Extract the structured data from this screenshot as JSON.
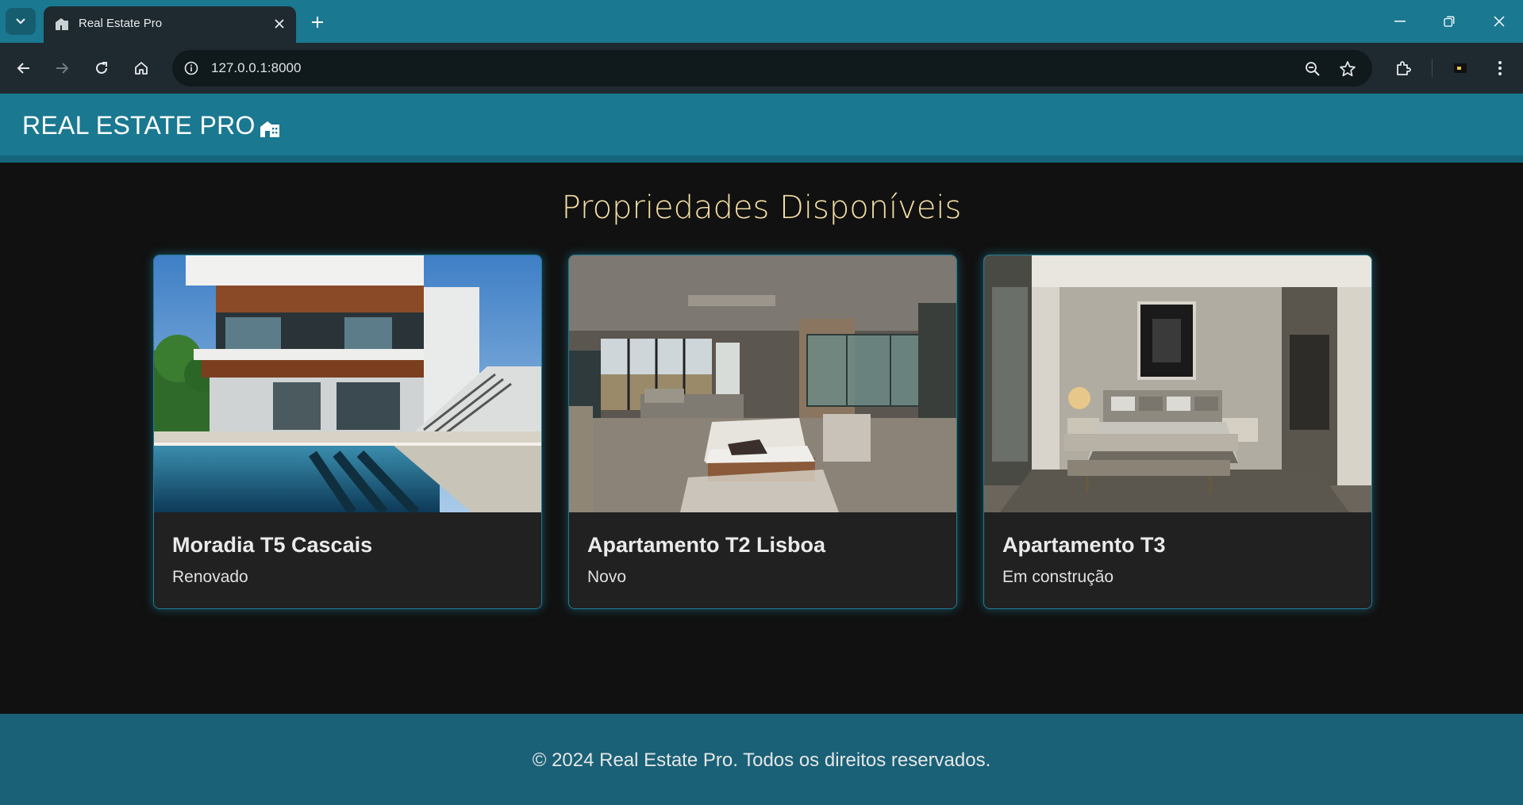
{
  "browser": {
    "tab_title": "Real Estate Pro",
    "url": "127.0.0.1:8000"
  },
  "site": {
    "brand": "REAL ESTATE PRO",
    "page_title": "Propriedades Disponíveis",
    "footer": "© 2024 Real Estate Pro. Todos os direitos reservados."
  },
  "properties": [
    {
      "title": "Moradia T5 Cascais",
      "status": "Renovado"
    },
    {
      "title": "Apartamento T2 Lisboa",
      "status": "Novo"
    },
    {
      "title": "Apartamento T3",
      "status": "Em construção"
    }
  ],
  "colors": {
    "header": "#1a7891",
    "page_bg": "#111111",
    "title_gold": "#f4dfa4",
    "card_bg": "#212121",
    "card_border": "#1e7b94",
    "footer": "#1a6177"
  }
}
